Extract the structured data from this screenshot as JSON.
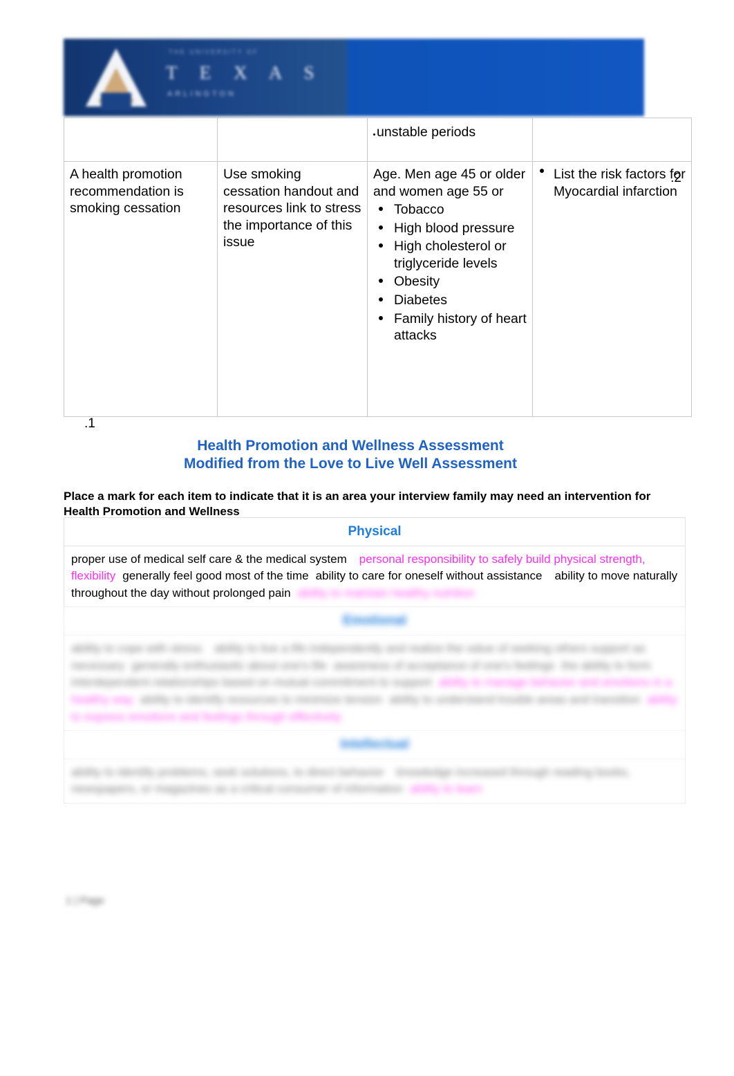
{
  "letterhead": {
    "institution_word": "T E X A S",
    "institution_top": "THE UNIVERSITY OF",
    "institution_sub": "ARLINGTON",
    "banner_color": "#124a9e"
  },
  "top_table": {
    "header_row": {
      "col1": "",
      "col2": "",
      "col3": "unstable periods",
      "col4": ""
    },
    "body_row": {
      "col1": "A health promotion recommendation is smoking cessation",
      "col2": "Use smoking cessation handout and resources link to stress the importance of this issue",
      "col3_lead": "Age. Men age 45 or older and women age 55 or",
      "col3_bullets": [
        "Tobacco",
        "High blood pressure",
        "High cholesterol or triglyceride levels",
        "Obesity",
        "Diabetes",
        "Family history of heart attacks"
      ],
      "col4_question": "List the risk factors for Myocardial infarction",
      "col4_number": ".2"
    }
  },
  "marker_one": ".1",
  "title": {
    "line1": "Health Promotion and Wellness Assessment",
    "line2": "Modified from the Love to Live Well Assessment",
    "color": "#1f62c4"
  },
  "instructions": "Place a mark for each item to indicate that it is an area your interview family may need an intervention for Health Promotion and Wellness",
  "assessment": {
    "sections": [
      {
        "name": "Physical",
        "heading_blurred": false,
        "items": [
          {
            "text": "proper use of medical self care & the medical system",
            "highlight": false
          },
          {
            "text": "personal responsibility to safely build physical strength, flexibility",
            "highlight": true
          },
          {
            "text": "generally feel good most of the time",
            "highlight": false
          },
          {
            "text": "ability to care for oneself without assistance",
            "highlight": false
          },
          {
            "text": "ability to move naturally throughout the day without prolonged pain",
            "highlight": false
          },
          {
            "text": "ability to maintain healthy nutrition",
            "highlight": true,
            "blurred": true
          }
        ],
        "body_blurred": false
      },
      {
        "name": "Emotional",
        "heading_blurred": true,
        "items": [
          {
            "text": "ability to cope with stress",
            "highlight": false,
            "blurred": true
          },
          {
            "text": "ability to live a life independently and realize the value of seeking others support as necessary",
            "highlight": false,
            "blurred": true
          },
          {
            "text": "generally enthusiastic about one's life",
            "highlight": false,
            "blurred": true
          },
          {
            "text": "awareness of acceptance of one's feelings",
            "highlight": false,
            "blurred": true
          },
          {
            "text": "the ability to form interdependent relationships based on mutual commitment to support",
            "highlight": false,
            "blurred": true
          },
          {
            "text": "ability to manage behavior and emotions in a healthy way",
            "highlight": true,
            "blurred": true
          },
          {
            "text": "ability to identify resources to minimize tension",
            "highlight": false,
            "blurred": true
          },
          {
            "text": "ability to understand trouble areas and transition",
            "highlight": false,
            "blurred": true
          },
          {
            "text": "ability to express emotions and feelings through effectively",
            "highlight": true,
            "blurred": true
          }
        ],
        "body_blurred": true
      },
      {
        "name": "Intellectual",
        "heading_blurred": true,
        "items": [
          {
            "text": "ability to identify problems, seek solutions, to direct behavior",
            "highlight": false,
            "blurred": true
          },
          {
            "text": "knowledge increased through reading books, newspapers, or magazines as a critical consumer of information",
            "highlight": false,
            "blurred": true
          },
          {
            "text": "ability to learn",
            "highlight": true,
            "blurred": true
          }
        ],
        "body_blurred": true
      }
    ]
  },
  "footer": "1 | Page",
  "colors": {
    "title_blue": "#1f62c4",
    "section_blue": "#1f7ddb",
    "highlight_magenta": "#ff2ef0",
    "banner_blue": "#124a9e"
  }
}
